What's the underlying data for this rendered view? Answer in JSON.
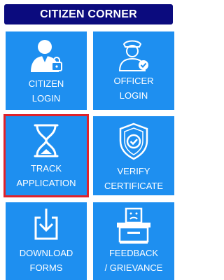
{
  "header": {
    "title": "CITIZEN CORNER"
  },
  "tiles": [
    {
      "name": "citizen-login",
      "line1": "CITIZEN",
      "line2": "LOGIN",
      "icon": "user-lock-icon"
    },
    {
      "name": "officer-login",
      "line1": "OFFICER",
      "line2": "LOGIN",
      "icon": "officer-check-icon"
    },
    {
      "name": "track-application",
      "line1": "TRACK",
      "line2": "APPLICATION",
      "icon": "hourglass-icon",
      "selected": true
    },
    {
      "name": "verify-certificate",
      "line1": "VERIFY",
      "line2": "CERTIFICATE",
      "icon": "shield-check-icon"
    },
    {
      "name": "download-forms",
      "line1": "DOWNLOAD",
      "line2": "FORMS",
      "icon": "download-icon"
    },
    {
      "name": "feedback-grievance",
      "line1": "FEEDBACK",
      "line2": "/ GRIEVANCE",
      "icon": "complaint-box-icon"
    }
  ],
  "colors": {
    "header_bg": "#0b0b7e",
    "tile_bg": "#1e8ff0",
    "selected_border": "#e0222b"
  }
}
